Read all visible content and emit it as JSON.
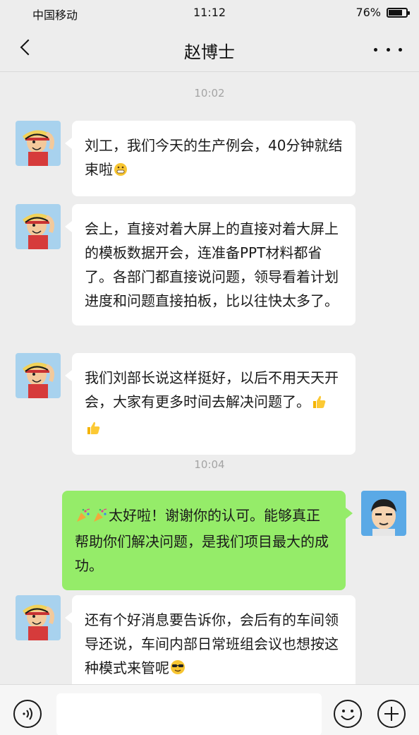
{
  "status_bar": {
    "carrier": "中国移动",
    "time": "11:12",
    "battery": "76%"
  },
  "nav": {
    "title": "赵博士",
    "back_icon": "chevron-left-icon",
    "more_icon": "more-dots-icon"
  },
  "chat": {
    "timestamps": [
      "10:02",
      "10:04"
    ],
    "messages": [
      {
        "side": "left",
        "sender_avatar": "avatar-liu",
        "text": "刘工，我们今天的生产例会，40分钟就结束啦",
        "trailing_emoji": "grinning-face-emoji"
      },
      {
        "side": "left",
        "sender_avatar": "avatar-liu",
        "text": "会上，直接对着大屏上的直接对着大屏上的模板数据开会，连准备PPT材料都省了。各部门都直接说问题，领导看着计划进度和问题直接拍板，比以往快太多了。"
      },
      {
        "side": "left",
        "sender_avatar": "avatar-liu",
        "text": "我们刘部长说这样挺好，以后不用天天开会，大家有更多时间去解决问题了。",
        "trailing_emoji": "thumbs-up-emoji x2"
      },
      {
        "side": "right",
        "sender_avatar": "avatar-zhao",
        "leading_emoji": "party-popper-emoji x2",
        "text": "太好啦！谢谢你的认可。能够真正帮助你们解决问题，是我们项目最大的成功。"
      },
      {
        "side": "left",
        "sender_avatar": "avatar-liu",
        "text": "还有个好消息要告诉你，会后有的车间领导还说，车间内部日常班组会议也想按这种模式来管呢",
        "trailing_emoji": "sunglasses-face-emoji"
      }
    ]
  },
  "input_bar": {
    "voice_icon": "voice-icon",
    "emoji_icon": "smiley-icon",
    "add_icon": "plus-circle-icon",
    "input_value": ""
  },
  "colors": {
    "background": "#ededed",
    "bubble_left": "#ffffff",
    "bubble_right": "#95ec69",
    "timestamp_text": "#a4a4a4"
  }
}
